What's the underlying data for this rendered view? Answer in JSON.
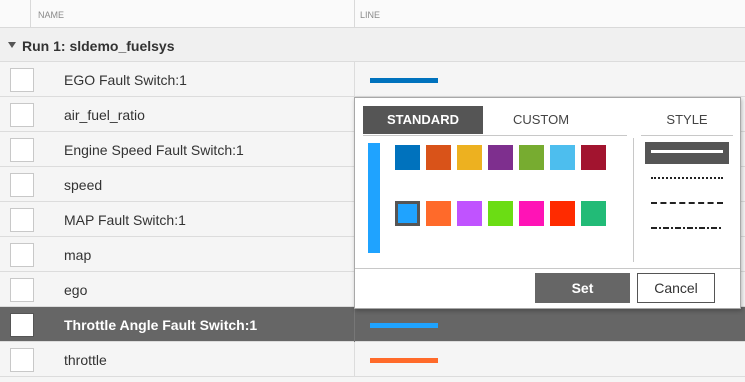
{
  "table": {
    "columns": [
      "NAME",
      "LINE"
    ],
    "group": {
      "label": "Run 1: sldemo_fuelsys",
      "expanded": true
    },
    "rows": [
      {
        "name": "EGO Fault Switch:1",
        "line_color": "#0072BD",
        "selected": false
      },
      {
        "name": "air_fuel_ratio",
        "line_color": null,
        "selected": false
      },
      {
        "name": "Engine Speed Fault Switch:1",
        "line_color": null,
        "selected": false
      },
      {
        "name": "speed",
        "line_color": null,
        "selected": false
      },
      {
        "name": "MAP Fault Switch:1",
        "line_color": null,
        "selected": false
      },
      {
        "name": "map",
        "line_color": null,
        "selected": false
      },
      {
        "name": "ego",
        "line_color": null,
        "selected": false
      },
      {
        "name": "Throttle Angle Fault Switch:1",
        "line_color": "#1FA3FF",
        "selected": true
      },
      {
        "name": "throttle",
        "line_color": "#FF6A2A",
        "selected": false
      }
    ]
  },
  "popup": {
    "tabs": {
      "standard": "STANDARD",
      "custom": "CUSTOM",
      "style": "STYLE"
    },
    "active_tab": "STANDARD",
    "selected_color": "#1FA3FF",
    "swatches_row1": [
      "#0072BD",
      "#D95319",
      "#EDB120",
      "#7E2F8E",
      "#77AC30",
      "#4DBEEE",
      "#A2142F"
    ],
    "swatches_row2": [
      "#1FA3FF",
      "#FF6A2A",
      "#C053FF",
      "#6BDD14",
      "#FF13B6",
      "#FF2B00",
      "#22BB77"
    ],
    "styles": [
      "solid",
      "dotted",
      "dashed",
      "dash-dot"
    ],
    "active_style": "solid",
    "set_label": "Set",
    "cancel_label": "Cancel"
  }
}
